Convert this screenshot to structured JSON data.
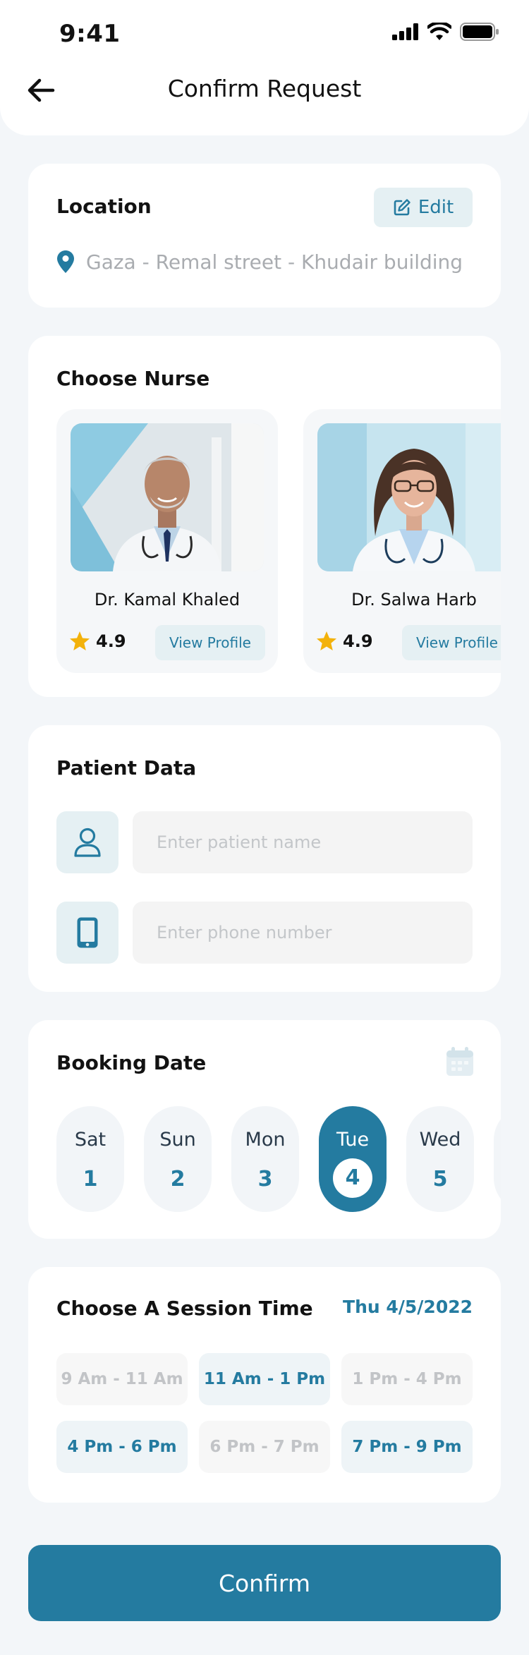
{
  "status_bar": {
    "time": "9:41"
  },
  "header": {
    "title": "Confirm Request"
  },
  "location": {
    "title": "Location",
    "edit_label": "Edit",
    "address": "Gaza - Remal street - Khudair building"
  },
  "nurses": {
    "title": "Choose Nurse",
    "items": [
      {
        "name": "Dr. Kamal Khaled",
        "rating": "4.9",
        "action": "View Profile"
      },
      {
        "name": "Dr. Salwa Harb",
        "rating": "4.9",
        "action": "View Profile"
      }
    ]
  },
  "patient": {
    "title": "Patient Data",
    "name_placeholder": "Enter patient name",
    "phone_placeholder": "Enter phone number"
  },
  "booking": {
    "title": "Booking Date",
    "days": [
      {
        "name": "Sat",
        "num": "1"
      },
      {
        "name": "Sun",
        "num": "2"
      },
      {
        "name": "Mon",
        "num": "3"
      },
      {
        "name": "Tue",
        "num": "4",
        "selected": true
      },
      {
        "name": "Wed",
        "num": "5"
      }
    ]
  },
  "session": {
    "title": "Choose A Session Time",
    "date": "Thu 4/5/2022",
    "slots": [
      {
        "label": "9 Am - 11 Am",
        "available": false
      },
      {
        "label": "11 Am - 1 Pm",
        "available": true
      },
      {
        "label": "1 Pm - 4 Pm",
        "available": false
      },
      {
        "label": "4 Pm - 6 Pm",
        "available": true
      },
      {
        "label": "6 Pm - 7 Pm",
        "available": false
      },
      {
        "label": "7 Pm - 9 Pm",
        "available": true
      }
    ]
  },
  "confirm_label": "Confirm",
  "colors": {
    "primary": "#247ba0",
    "primary_soft": "#e5f0f3",
    "background": "#f3f6f9",
    "star": "#f3b20b"
  }
}
